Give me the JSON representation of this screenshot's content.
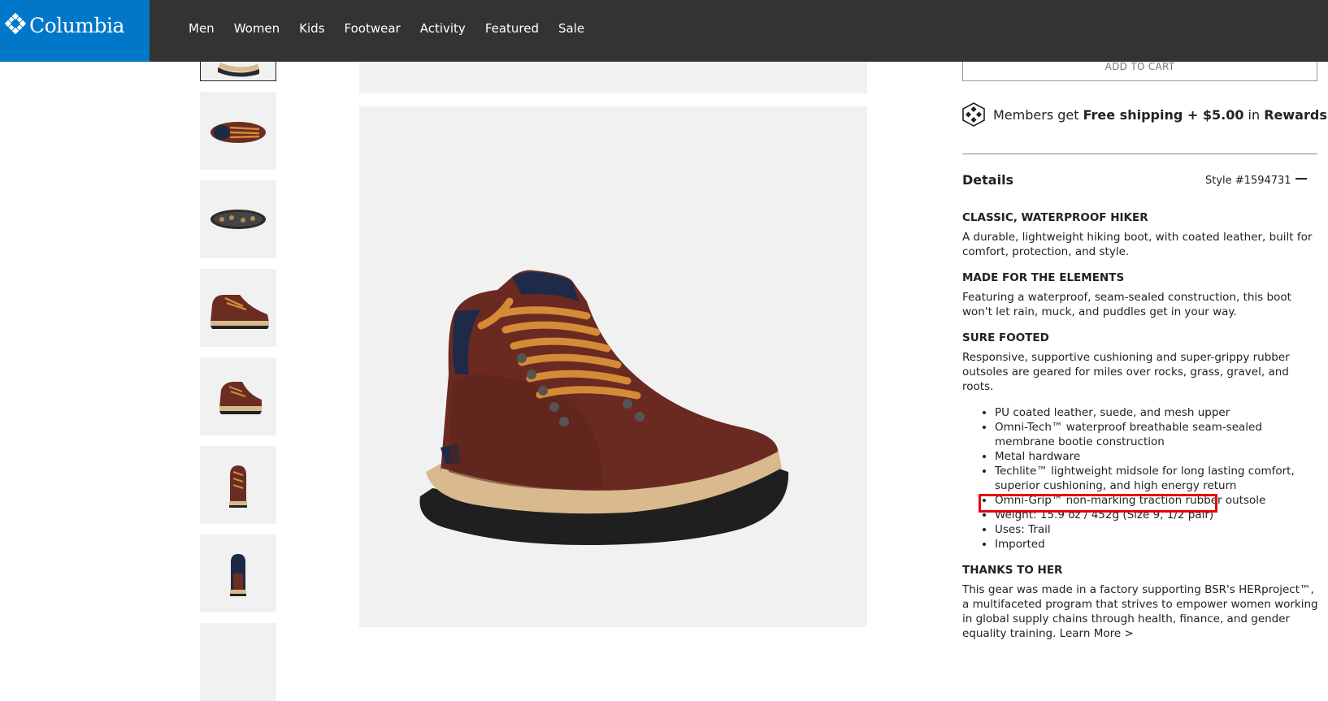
{
  "header": {
    "logo_text": "Columbia",
    "nav": [
      "Men",
      "Women",
      "Kids",
      "Footwear",
      "Activity",
      "Featured",
      "Sale"
    ]
  },
  "thumbnails": [
    "thumb-1",
    "thumb-2",
    "thumb-3",
    "thumb-4",
    "thumb-5",
    "thumb-6",
    "thumb-7",
    "thumb-8"
  ],
  "product": {
    "add_to_cart": "ADD TO CART",
    "members": {
      "pre": "Members get ",
      "bold1": "Free shipping + $5.00",
      "mid": " in ",
      "bold2": "Rewards"
    },
    "details": {
      "title": "Details",
      "style": "Style #1594731",
      "sections": [
        {
          "heading": "CLASSIC, WATERPROOF HIKER",
          "body": "A durable, lightweight hiking boot, with coated leather, built for comfort, protection, and style."
        },
        {
          "heading": "MADE FOR THE ELEMENTS",
          "body": "Featuring a waterproof, seam-sealed construction, this boot won't let rain, muck, and puddles get in your way."
        },
        {
          "heading": "SURE FOOTED",
          "body": "Responsive, supportive cushioning and super-grippy rubber outsoles are geared for miles over rocks, grass, gravel, and roots."
        }
      ],
      "bullets": [
        "PU coated leather, suede, and mesh upper",
        "Omni-Tech™ waterproof breathable seam-sealed membrane bootie construction",
        "Metal hardware",
        "Techlite™ lightweight midsole for long lasting comfort, superior cushioning, and high energy return",
        "Omni-Grip™ non-marking traction rubber outsole",
        "Weight: 15.9 oz / 452g (Size 9, 1/2 pair)",
        "Uses: Trail",
        "Imported"
      ],
      "thanks_heading": "THANKS TO HER",
      "thanks_body": "This gear was made in a factory supporting BSR's HERproject™, a multifaceted program that strives to empower women working in global supply chains through health, finance, and gender equality training. ",
      "learn_more": "Learn More >"
    }
  },
  "colors": {
    "brand_blue": "#0077c8",
    "header_bg": "#333333",
    "highlight": "#e8000d"
  }
}
